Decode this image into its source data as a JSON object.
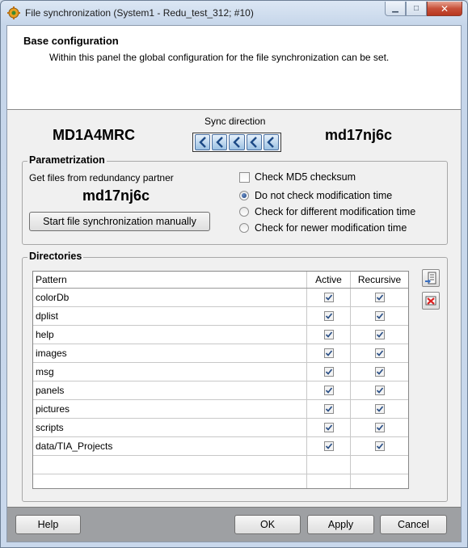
{
  "window": {
    "title": "File synchronization (System1 - Redu_test_312; #10)"
  },
  "header": {
    "title": "Base configuration",
    "description": "Within this panel the global configuration for the file synchronization can be set."
  },
  "sync": {
    "label": "Sync direction",
    "host_left": "MD1A4MRC",
    "host_right": "md17nj6c",
    "arrow_count": 5,
    "arrow_icon": "arrow-left-icon"
  },
  "param": {
    "title": "Parametrization",
    "get_files_label": "Get files from redundancy partner",
    "partner": "md17nj6c",
    "start_button": "Start file synchronization manually",
    "md5_label": "Check MD5 checksum",
    "md5_checked": false,
    "radio_options": [
      {
        "label": "Do not check modification time",
        "selected": true
      },
      {
        "label": "Check for different modification time",
        "selected": false
      },
      {
        "label": "Check for newer modification time",
        "selected": false
      }
    ]
  },
  "dirs": {
    "title": "Directories",
    "columns": [
      "Pattern",
      "Active",
      "Recursive"
    ],
    "rows": [
      {
        "pattern": "colorDb",
        "active": true,
        "recursive": true
      },
      {
        "pattern": "dplist",
        "active": true,
        "recursive": true
      },
      {
        "pattern": "help",
        "active": true,
        "recursive": true
      },
      {
        "pattern": "images",
        "active": true,
        "recursive": true
      },
      {
        "pattern": "msg",
        "active": true,
        "recursive": true
      },
      {
        "pattern": "panels",
        "active": true,
        "recursive": true
      },
      {
        "pattern": "pictures",
        "active": true,
        "recursive": true
      },
      {
        "pattern": "scripts",
        "active": true,
        "recursive": true
      },
      {
        "pattern": "data/TIA_Projects",
        "active": true,
        "recursive": true
      }
    ],
    "empty_rows": 2
  },
  "footer": {
    "help": "Help",
    "ok": "OK",
    "apply": "Apply",
    "cancel": "Cancel"
  },
  "colors": {
    "header_bg": "#ffffff",
    "client_bg": "#f0f0f0",
    "footer_bg": "#9ea0a3",
    "close_red": "#c7503a"
  }
}
